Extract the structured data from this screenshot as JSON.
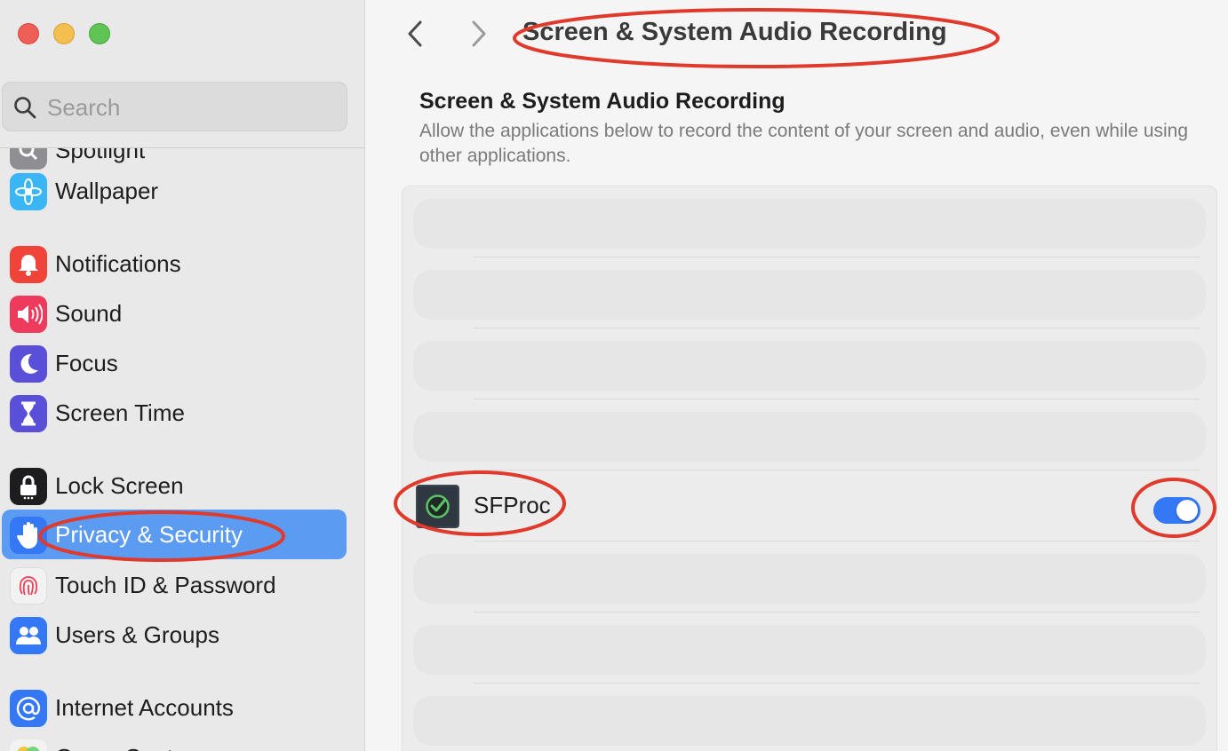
{
  "window": {
    "title": "Screen & System Audio Recording"
  },
  "search": {
    "placeholder": "Search"
  },
  "sidebar": {
    "items": [
      {
        "label": "Spotlight",
        "icon": "spotlight-icon",
        "color": "#8e8e93"
      },
      {
        "label": "Wallpaper",
        "icon": "wallpaper-icon",
        "color": "#3ab5f5"
      },
      {
        "label": "Notifications",
        "icon": "bell-icon",
        "color": "#f0443a"
      },
      {
        "label": "Sound",
        "icon": "speaker-icon",
        "color": "#ee3a5c"
      },
      {
        "label": "Focus",
        "icon": "moon-icon",
        "color": "#5a4fd9"
      },
      {
        "label": "Screen Time",
        "icon": "hourglass-icon",
        "color": "#5a4fd9"
      },
      {
        "label": "Lock Screen",
        "icon": "lock-icon",
        "color": "#1d1d1f"
      },
      {
        "label": "Privacy & Security",
        "icon": "hand-icon",
        "color": "#3478f6",
        "selected": true
      },
      {
        "label": "Touch ID & Password",
        "icon": "fingerprint-icon",
        "color": "#f2f2f2"
      },
      {
        "label": "Users & Groups",
        "icon": "users-icon",
        "color": "#3478f6"
      },
      {
        "label": "Internet Accounts",
        "icon": "at-icon",
        "color": "#3478f6"
      },
      {
        "label": "Game Center",
        "icon": "game-center-icon",
        "color": "#f2f2f2"
      }
    ]
  },
  "main": {
    "section_title": "Screen & System Audio Recording",
    "section_description": "Allow the applications below to record the content of your screen and audio, even while using other applications.",
    "apps": [
      {
        "name": "SFProc",
        "enabled": true
      }
    ]
  },
  "colors": {
    "accent": "#3478f6",
    "selection": "#5b9cf2",
    "annotation": "#e03a2c"
  }
}
